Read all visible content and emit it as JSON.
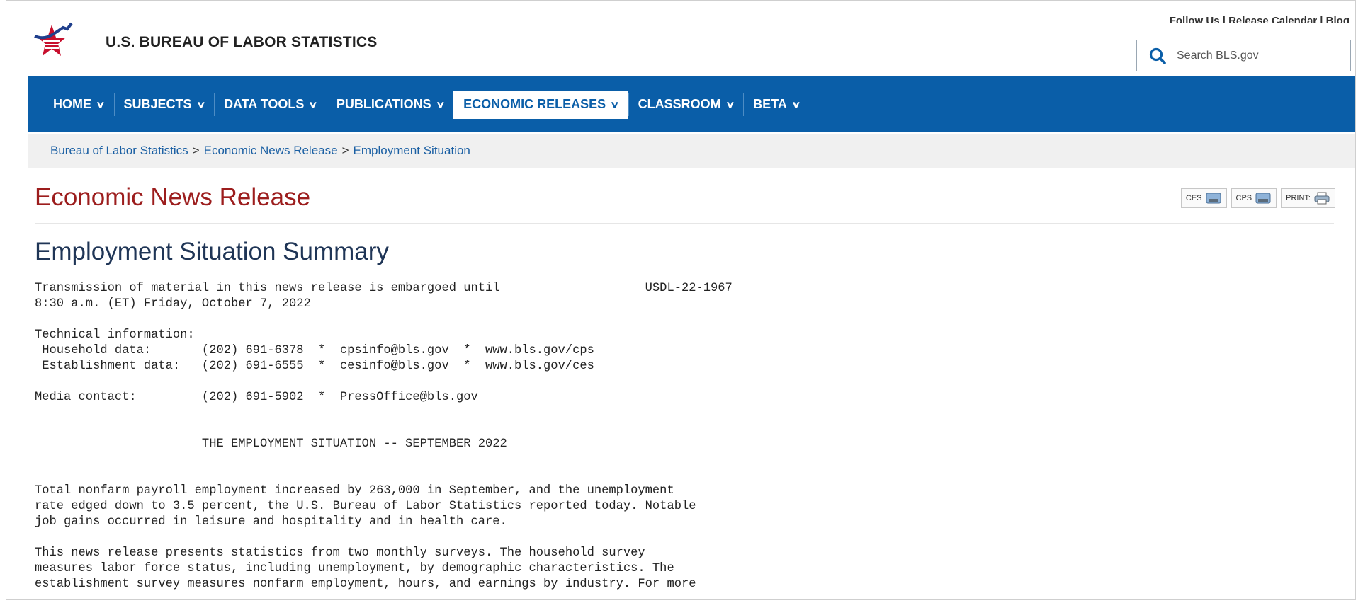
{
  "header": {
    "site_name": "U.S. BUREAU OF LABOR STATISTICS",
    "util_links": "Follow Us  | Release Calendar | Blog",
    "search_placeholder": "Search BLS.gov"
  },
  "nav": {
    "items": [
      {
        "label": "HOME"
      },
      {
        "label": "SUBJECTS"
      },
      {
        "label": "DATA TOOLS"
      },
      {
        "label": "PUBLICATIONS"
      },
      {
        "label": "ECONOMIC RELEASES"
      },
      {
        "label": "CLASSROOM"
      },
      {
        "label": "BETA"
      }
    ]
  },
  "breadcrumb": {
    "items": [
      "Bureau of Labor Statistics",
      "Economic News Release",
      "Employment Situation"
    ],
    "separator": ">"
  },
  "page": {
    "title": "Economic News Release",
    "tools": {
      "ces": "CES",
      "cps": "CPS",
      "print": "PRINT:"
    },
    "summary_title": "Employment Situation Summary"
  },
  "release_text": "Transmission of material in this news release is embargoed until                    USDL-22-1967\n8:30 a.m. (ET) Friday, October 7, 2022\n\nTechnical information:\n Household data:       (202) 691-6378  *  cpsinfo@bls.gov  *  www.bls.gov/cps\n Establishment data:   (202) 691-6555  *  cesinfo@bls.gov  *  www.bls.gov/ces\n\nMedia contact:         (202) 691-5902  *  PressOffice@bls.gov\n\n\n                       THE EMPLOYMENT SITUATION -- SEPTEMBER 2022\n\n\nTotal nonfarm payroll employment increased by 263,000 in September, and the unemployment\nrate edged down to 3.5 percent, the U.S. Bureau of Labor Statistics reported today. Notable\njob gains occurred in leisure and hospitality and in health care.\n\nThis news release presents statistics from two monthly surveys. The household survey\nmeasures labor force status, including unemployment, by demographic characteristics. The\nestablishment survey measures nonfarm employment, hours, and earnings by industry. For more",
  "colors": {
    "nav_bg": "#0a5ea8",
    "title_red": "#9c1d1d",
    "summary_navy": "#1f3556",
    "link_blue": "#1a5fa3"
  }
}
